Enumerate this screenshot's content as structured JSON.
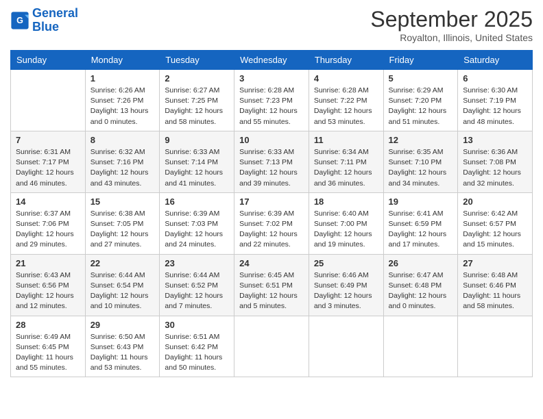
{
  "header": {
    "logo_line1": "General",
    "logo_line2": "Blue",
    "month": "September 2025",
    "location": "Royalton, Illinois, United States"
  },
  "days_of_week": [
    "Sunday",
    "Monday",
    "Tuesday",
    "Wednesday",
    "Thursday",
    "Friday",
    "Saturday"
  ],
  "weeks": [
    [
      {
        "day": "",
        "info": ""
      },
      {
        "day": "1",
        "info": "Sunrise: 6:26 AM\nSunset: 7:26 PM\nDaylight: 13 hours\nand 0 minutes."
      },
      {
        "day": "2",
        "info": "Sunrise: 6:27 AM\nSunset: 7:25 PM\nDaylight: 12 hours\nand 58 minutes."
      },
      {
        "day": "3",
        "info": "Sunrise: 6:28 AM\nSunset: 7:23 PM\nDaylight: 12 hours\nand 55 minutes."
      },
      {
        "day": "4",
        "info": "Sunrise: 6:28 AM\nSunset: 7:22 PM\nDaylight: 12 hours\nand 53 minutes."
      },
      {
        "day": "5",
        "info": "Sunrise: 6:29 AM\nSunset: 7:20 PM\nDaylight: 12 hours\nand 51 minutes."
      },
      {
        "day": "6",
        "info": "Sunrise: 6:30 AM\nSunset: 7:19 PM\nDaylight: 12 hours\nand 48 minutes."
      }
    ],
    [
      {
        "day": "7",
        "info": "Sunrise: 6:31 AM\nSunset: 7:17 PM\nDaylight: 12 hours\nand 46 minutes."
      },
      {
        "day": "8",
        "info": "Sunrise: 6:32 AM\nSunset: 7:16 PM\nDaylight: 12 hours\nand 43 minutes."
      },
      {
        "day": "9",
        "info": "Sunrise: 6:33 AM\nSunset: 7:14 PM\nDaylight: 12 hours\nand 41 minutes."
      },
      {
        "day": "10",
        "info": "Sunrise: 6:33 AM\nSunset: 7:13 PM\nDaylight: 12 hours\nand 39 minutes."
      },
      {
        "day": "11",
        "info": "Sunrise: 6:34 AM\nSunset: 7:11 PM\nDaylight: 12 hours\nand 36 minutes."
      },
      {
        "day": "12",
        "info": "Sunrise: 6:35 AM\nSunset: 7:10 PM\nDaylight: 12 hours\nand 34 minutes."
      },
      {
        "day": "13",
        "info": "Sunrise: 6:36 AM\nSunset: 7:08 PM\nDaylight: 12 hours\nand 32 minutes."
      }
    ],
    [
      {
        "day": "14",
        "info": "Sunrise: 6:37 AM\nSunset: 7:06 PM\nDaylight: 12 hours\nand 29 minutes."
      },
      {
        "day": "15",
        "info": "Sunrise: 6:38 AM\nSunset: 7:05 PM\nDaylight: 12 hours\nand 27 minutes."
      },
      {
        "day": "16",
        "info": "Sunrise: 6:39 AM\nSunset: 7:03 PM\nDaylight: 12 hours\nand 24 minutes."
      },
      {
        "day": "17",
        "info": "Sunrise: 6:39 AM\nSunset: 7:02 PM\nDaylight: 12 hours\nand 22 minutes."
      },
      {
        "day": "18",
        "info": "Sunrise: 6:40 AM\nSunset: 7:00 PM\nDaylight: 12 hours\nand 19 minutes."
      },
      {
        "day": "19",
        "info": "Sunrise: 6:41 AM\nSunset: 6:59 PM\nDaylight: 12 hours\nand 17 minutes."
      },
      {
        "day": "20",
        "info": "Sunrise: 6:42 AM\nSunset: 6:57 PM\nDaylight: 12 hours\nand 15 minutes."
      }
    ],
    [
      {
        "day": "21",
        "info": "Sunrise: 6:43 AM\nSunset: 6:56 PM\nDaylight: 12 hours\nand 12 minutes."
      },
      {
        "day": "22",
        "info": "Sunrise: 6:44 AM\nSunset: 6:54 PM\nDaylight: 12 hours\nand 10 minutes."
      },
      {
        "day": "23",
        "info": "Sunrise: 6:44 AM\nSunset: 6:52 PM\nDaylight: 12 hours\nand 7 minutes."
      },
      {
        "day": "24",
        "info": "Sunrise: 6:45 AM\nSunset: 6:51 PM\nDaylight: 12 hours\nand 5 minutes."
      },
      {
        "day": "25",
        "info": "Sunrise: 6:46 AM\nSunset: 6:49 PM\nDaylight: 12 hours\nand 3 minutes."
      },
      {
        "day": "26",
        "info": "Sunrise: 6:47 AM\nSunset: 6:48 PM\nDaylight: 12 hours\nand 0 minutes."
      },
      {
        "day": "27",
        "info": "Sunrise: 6:48 AM\nSunset: 6:46 PM\nDaylight: 11 hours\nand 58 minutes."
      }
    ],
    [
      {
        "day": "28",
        "info": "Sunrise: 6:49 AM\nSunset: 6:45 PM\nDaylight: 11 hours\nand 55 minutes."
      },
      {
        "day": "29",
        "info": "Sunrise: 6:50 AM\nSunset: 6:43 PM\nDaylight: 11 hours\nand 53 minutes."
      },
      {
        "day": "30",
        "info": "Sunrise: 6:51 AM\nSunset: 6:42 PM\nDaylight: 11 hours\nand 50 minutes."
      },
      {
        "day": "",
        "info": ""
      },
      {
        "day": "",
        "info": ""
      },
      {
        "day": "",
        "info": ""
      },
      {
        "day": "",
        "info": ""
      }
    ]
  ]
}
